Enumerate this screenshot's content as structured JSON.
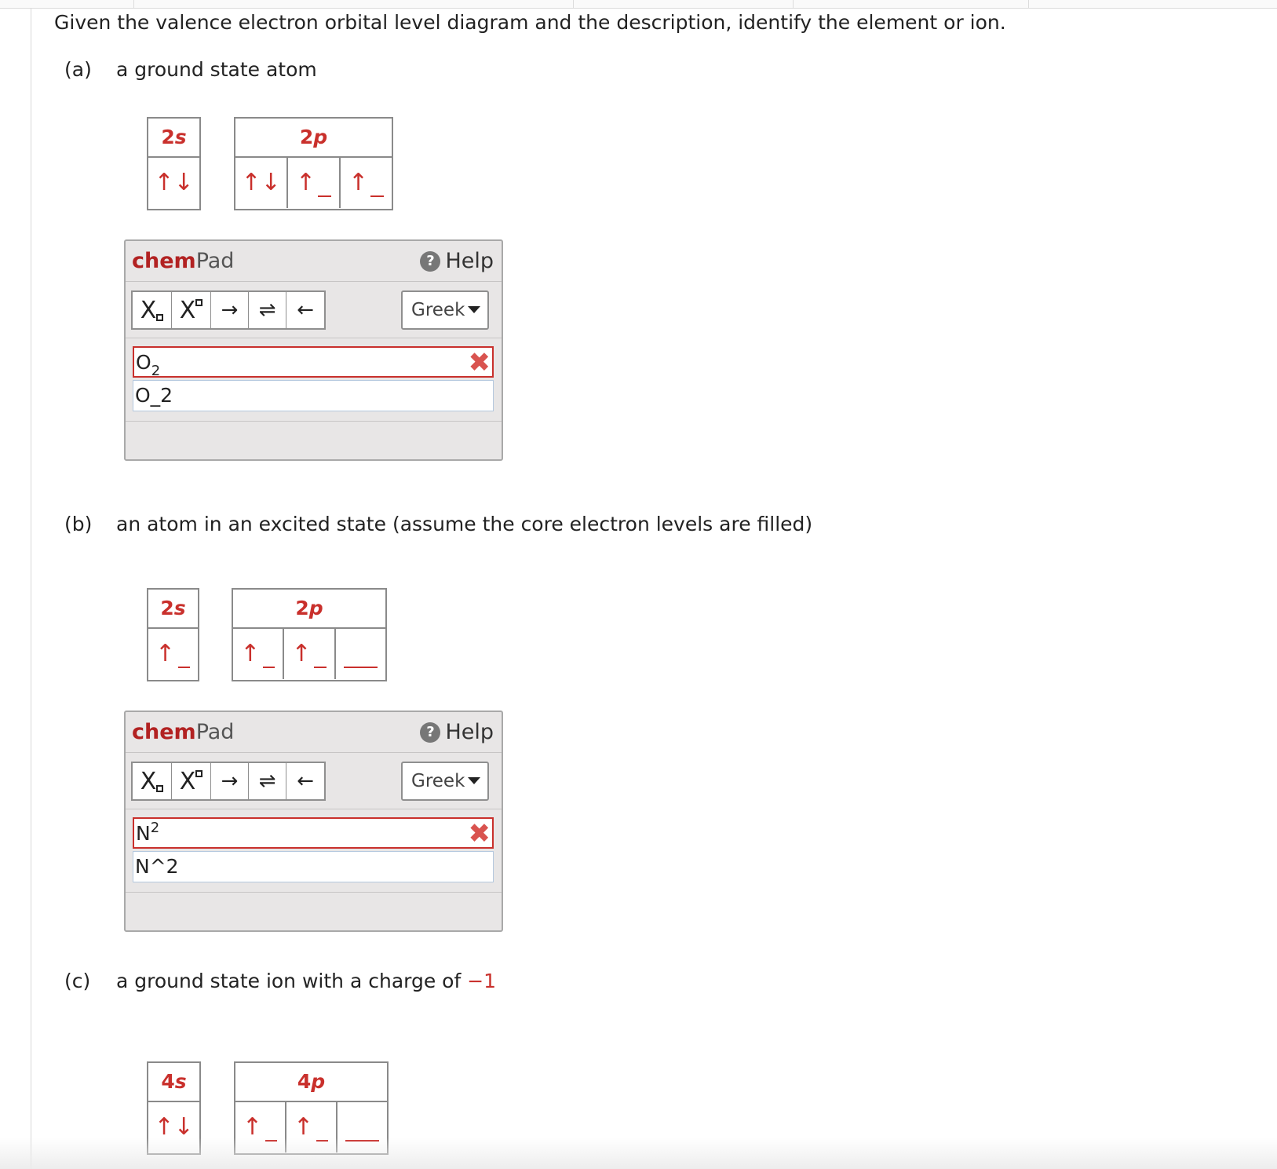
{
  "prompt": "Given the valence electron orbital level diagram and the description, identify the element or ion.",
  "questions": [
    {
      "letter": "(a)",
      "description": "a ground state atom",
      "orbitals": [
        {
          "label": "2",
          "sub": "s",
          "cells": [
            "↑↓"
          ]
        },
        {
          "label": "2",
          "sub": "p",
          "cells": [
            "↑↓",
            "↑",
            "↑"
          ]
        }
      ],
      "chempad": {
        "title_chem": "chem",
        "title_pad": "Pad",
        "help": "Help",
        "greek": "Greek",
        "answer_main": "O",
        "answer_script": "2",
        "answer_raw": "O_2",
        "status": "incorrect"
      }
    },
    {
      "letter": "(b)",
      "description": "an atom in an excited state (assume the core electron levels are filled)",
      "orbitals": [
        {
          "label": "2",
          "sub": "s",
          "cells": [
            "↑"
          ]
        },
        {
          "label": "2",
          "sub": "p",
          "cells": [
            "↑",
            "↑",
            ""
          ]
        }
      ],
      "chempad": {
        "title_chem": "chem",
        "title_pad": "Pad",
        "help": "Help",
        "greek": "Greek",
        "answer_main": "N",
        "answer_script": "2",
        "answer_raw": "N^2",
        "status": "incorrect"
      }
    },
    {
      "letter": "(c)",
      "description": "a ground state ion with a charge of",
      "charge": "−1",
      "orbitals": [
        {
          "label": "4",
          "sub": "s",
          "cells": [
            "↑↓"
          ]
        },
        {
          "label": "4",
          "sub": "p",
          "cells": [
            "↑",
            "↑",
            ""
          ]
        }
      ]
    }
  ],
  "toolbar": {
    "subscript": "X",
    "superscript": "X",
    "arrow_right": "→",
    "equilibrium": "⇌",
    "arrow_left": "←"
  },
  "colors": {
    "accent": "#c9302c",
    "chem_brand": "#b22222",
    "error": "#d9534f"
  }
}
